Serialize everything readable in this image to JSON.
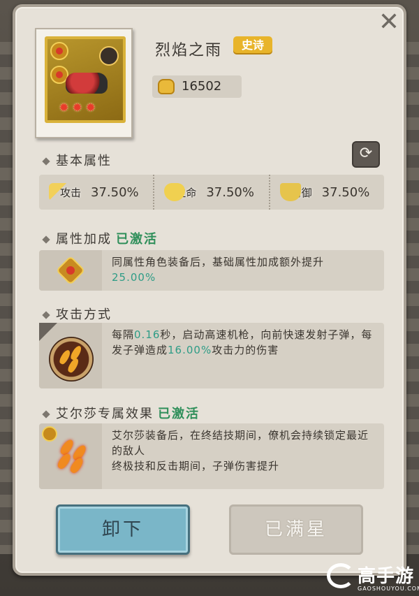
{
  "item": {
    "name": "烈焰之雨",
    "rarity": "史诗",
    "power": "16502",
    "stars": 3
  },
  "basic": {
    "title": "基本属性",
    "stats": [
      {
        "icon": "sword-icon",
        "label": "攻击",
        "value": "37.50%"
      },
      {
        "icon": "heart-icon",
        "label": "生命",
        "value": "37.50%"
      },
      {
        "icon": "shield-icon",
        "label": "防御",
        "value": "37.50%"
      }
    ]
  },
  "bonus": {
    "title": "属性加成",
    "status": "已激活",
    "text_before": "同属性角色装备后，基础属性加成额外提升",
    "highlight": "25.00%"
  },
  "attack": {
    "title": "攻击方式",
    "p1": "每隔",
    "v1": "0.16",
    "p2": "秒，启动高速机枪，向前快速发射子弹，每发子弹造成",
    "v2": "16.00%",
    "p3": "攻击力的伤害"
  },
  "exclusive": {
    "title": "艾尔莎专属效果",
    "status": "已激活",
    "line1": "艾尔莎装备后，在终结技期间，僚机会持续锁定最近的敌人",
    "line2": "终极技和反击期间，子弹伤害提升"
  },
  "buttons": {
    "unequip": "卸下",
    "max_star": "已满星"
  },
  "watermark": {
    "name": "高手游",
    "url": "GAOSHOUYOU.COM"
  },
  "colors": {
    "active": "#2f8f5a",
    "highlight": "#2e9c86",
    "rarity": "#e8b42a",
    "unequip": "#7ab6c8"
  }
}
